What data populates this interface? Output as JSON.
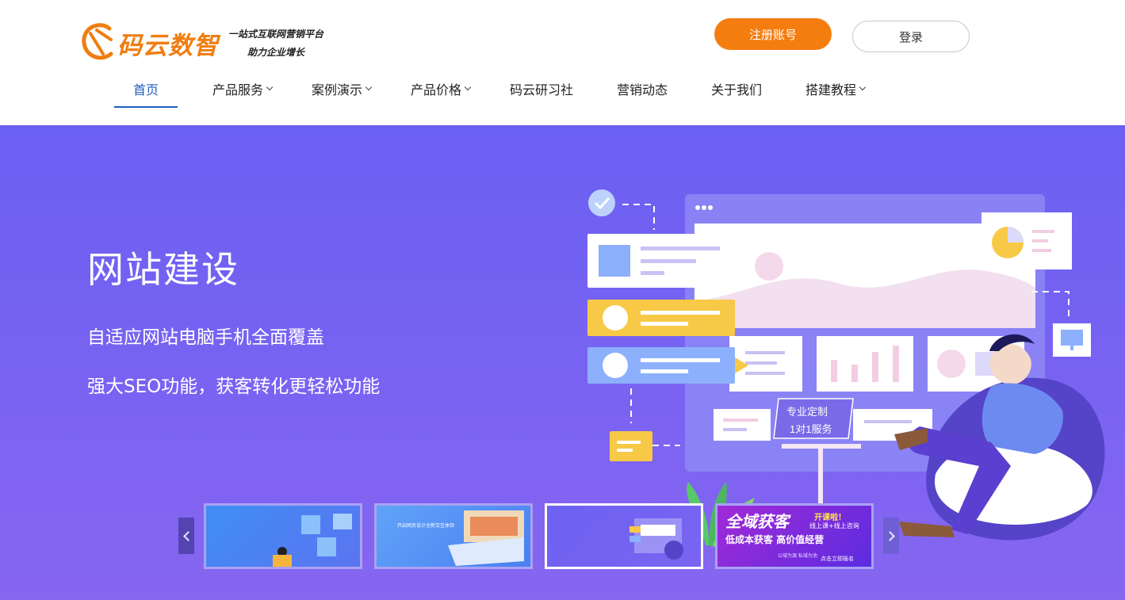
{
  "header": {
    "logo_name": "码云数智",
    "logo_tagline_1": "一站式互联网营销平台",
    "logo_tagline_2": "助力企业增长",
    "register_label": "注册账号",
    "login_label": "登录",
    "brand_color": "#f57d10"
  },
  "nav": {
    "items": [
      {
        "label": "首页",
        "has_dropdown": false,
        "active": true
      },
      {
        "label": "产品服务",
        "has_dropdown": true
      },
      {
        "label": "案例演示",
        "has_dropdown": true
      },
      {
        "label": "产品价格",
        "has_dropdown": true
      },
      {
        "label": "码云研习社",
        "has_dropdown": false
      },
      {
        "label": "营销动态",
        "has_dropdown": false
      },
      {
        "label": "关于我们",
        "has_dropdown": false
      },
      {
        "label": "搭建教程",
        "has_dropdown": true
      }
    ],
    "active_color": "#1f5fbf"
  },
  "banner": {
    "title": "网站建设",
    "subtitle_1": "自适应网站电脑手机全面覆盖",
    "subtitle_2": "强大SEO功能，获客转化更轻松功能",
    "illustration_tag_1": "专业定制",
    "illustration_tag_2": "1对1服务",
    "background_color": "#7063f2"
  },
  "carousel": {
    "active_index": 2,
    "thumb2_caption": "开启网页设计全新交互体验",
    "thumb4": {
      "title": "全域获客",
      "badge": "开课啦！",
      "small": "线上课+线上咨询",
      "line2": "低成本获客  高价值经营",
      "foot1": "公域为源 私域为池",
      "foot2": "点击立即报名"
    }
  }
}
